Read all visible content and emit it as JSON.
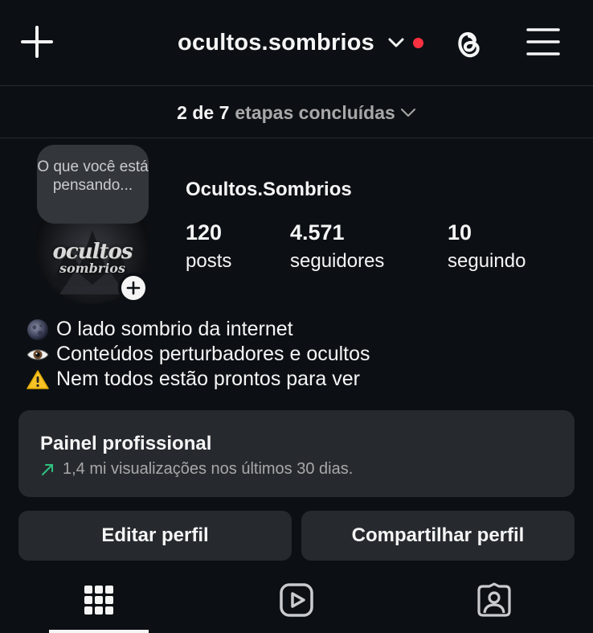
{
  "header": {
    "username": "ocultos.sombrios",
    "notification_dot_color": "#ff3040",
    "icons": [
      "plus-icon",
      "chevron-down-icon",
      "threads-icon",
      "hamburger-menu-icon"
    ]
  },
  "onboarding": {
    "steps_done": "2 de 7",
    "steps_label": "etapas concluídas"
  },
  "profile": {
    "note_text": "O que você está pensando...",
    "avatar_text_line1": "ocultos",
    "avatar_text_line2": "sombrios",
    "display_name": "Ocultos.Sombrios",
    "stats": [
      {
        "value": "120",
        "label": "posts"
      },
      {
        "value": "4.571",
        "label": "seguidores"
      },
      {
        "value": "10",
        "label": "seguindo"
      }
    ],
    "bio": [
      {
        "icon": "dark-moon-icon",
        "text": "O lado sombrio da internet"
      },
      {
        "icon": "eye-icon",
        "text": "Conteúdos perturbadores e ocultos"
      },
      {
        "icon": "warning-icon",
        "text": "Nem todos estão prontos para ver"
      }
    ]
  },
  "professional_panel": {
    "title": "Painel profissional",
    "subtitle": "1,4 mi visualizações nos últimos 30 dias.",
    "trend_color": "#2ec27e"
  },
  "actions": {
    "edit_profile": "Editar perfil",
    "share_profile": "Compartilhar perfil"
  },
  "tabs": [
    {
      "name": "grid",
      "icon": "grid-icon",
      "active": true
    },
    {
      "name": "reels",
      "icon": "reels-icon",
      "active": false
    },
    {
      "name": "tagged",
      "icon": "tagged-person-icon",
      "active": false
    }
  ]
}
